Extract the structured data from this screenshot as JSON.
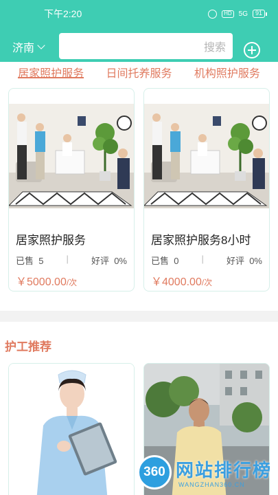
{
  "status_bar": {
    "time": "下午2:20",
    "hd": "HD",
    "network": "5G",
    "battery": "91"
  },
  "header": {
    "city": "济南",
    "search_placeholder": "搜索"
  },
  "tabs": [
    "居家照护服务",
    "日间托养服务",
    "机构照护服务"
  ],
  "services": [
    {
      "title": "居家照护服务",
      "sold_label": "已售",
      "sold": "5",
      "rating_label": "好评",
      "rating": "0%",
      "price": "￥5000.00",
      "unit": "/次"
    },
    {
      "title": "居家照护服务8小时",
      "sold_label": "已售",
      "sold": "0",
      "rating_label": "好评",
      "rating": "0%",
      "price": "￥4000.00",
      "unit": "/次"
    }
  ],
  "nurse_section": {
    "title": "护工推荐"
  },
  "watermark": {
    "logo": "360",
    "text": "网站排行榜",
    "sub": "WANGZHAN360.CN"
  },
  "colors": {
    "primary": "#3ecdb3",
    "accent": "#e07a5f"
  }
}
